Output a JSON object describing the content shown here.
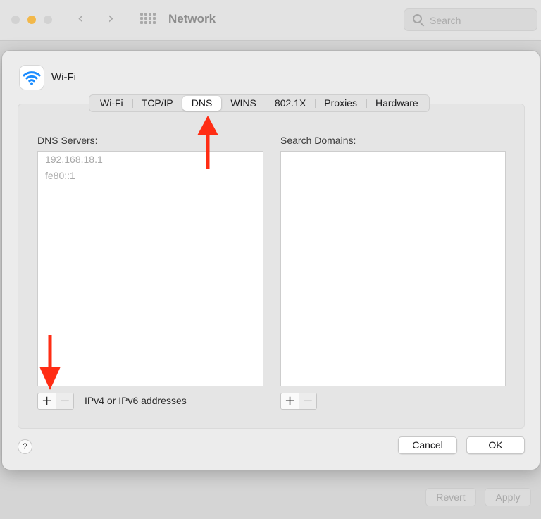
{
  "window": {
    "title": "Network",
    "search_placeholder": "Search",
    "revert_label": "Revert",
    "apply_label": "Apply"
  },
  "sheet": {
    "title": "Wi-Fi",
    "tabs": [
      {
        "label": "Wi-Fi"
      },
      {
        "label": "TCP/IP"
      },
      {
        "label": "DNS",
        "active": true
      },
      {
        "label": "WINS"
      },
      {
        "label": "802.1X"
      },
      {
        "label": "Proxies"
      },
      {
        "label": "Hardware"
      }
    ],
    "dns": {
      "label": "DNS Servers:",
      "servers": [
        "192.168.18.1",
        "fe80::1"
      ],
      "hint": "IPv4 or IPv6 addresses"
    },
    "search_domains": {
      "label": "Search Domains:"
    },
    "plus_label": "+",
    "minus_label": "−",
    "help_label": "?",
    "cancel_label": "Cancel",
    "ok_label": "OK"
  },
  "colors": {
    "annotation_arrow": "#ff2d14",
    "wifi_blue": "#1a8cff"
  },
  "icons": [
    "wifi-icon",
    "search-icon",
    "back-arrow-icon",
    "forward-arrow-icon",
    "grid-icon"
  ]
}
